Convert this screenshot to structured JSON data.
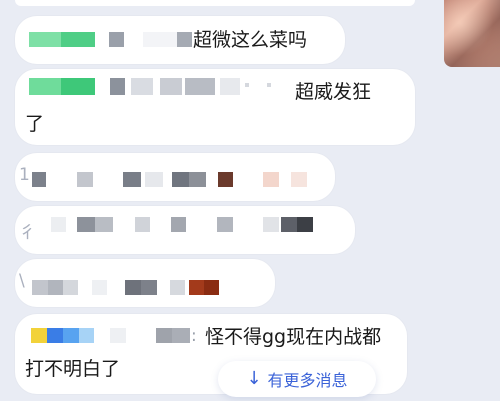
{
  "messages": [
    {
      "id": 1,
      "text": "超微这么菜吗"
    },
    {
      "id": 2,
      "text": "超威发狂",
      "text_cont": "了"
    },
    {
      "id": 3,
      "text": ""
    },
    {
      "id": 4,
      "text": ""
    },
    {
      "id": 5,
      "text": ""
    },
    {
      "id": 6,
      "text": "怪不得gg现在内战都",
      "text_cont": "打不明白了"
    }
  ],
  "more_messages_button": {
    "label": "有更多消息",
    "icon": "arrow-down-icon"
  },
  "colors": {
    "accent": "#3b63d8",
    "background": "#e9ecf4",
    "bubble": "#ffffff"
  }
}
